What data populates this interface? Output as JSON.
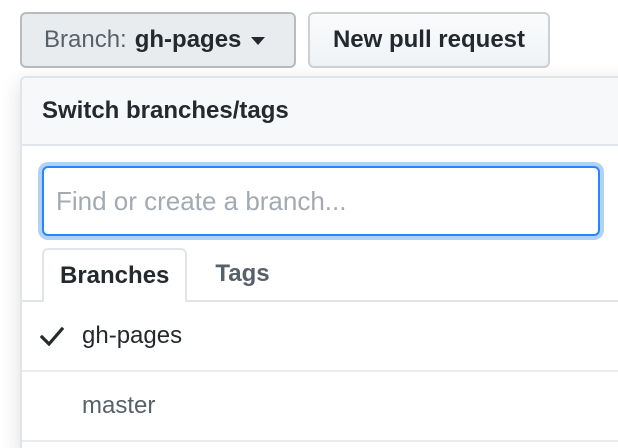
{
  "toolbar": {
    "branch_prefix": "Branch:",
    "branch_name": "gh-pages",
    "new_pr_label": "New pull request"
  },
  "dropdown": {
    "title": "Switch branches/tags",
    "filter": {
      "placeholder": "Find or create a branch...",
      "value": ""
    },
    "tabs": [
      {
        "label": "Branches",
        "active": true
      },
      {
        "label": "Tags",
        "active": false
      }
    ],
    "items": [
      {
        "name": "gh-pages",
        "selected": true,
        "icon": "check-icon"
      },
      {
        "name": "master",
        "selected": false
      }
    ]
  },
  "colors": {
    "focus_border": "#2188ff",
    "text_primary": "#24292e",
    "text_muted": "#586069"
  }
}
